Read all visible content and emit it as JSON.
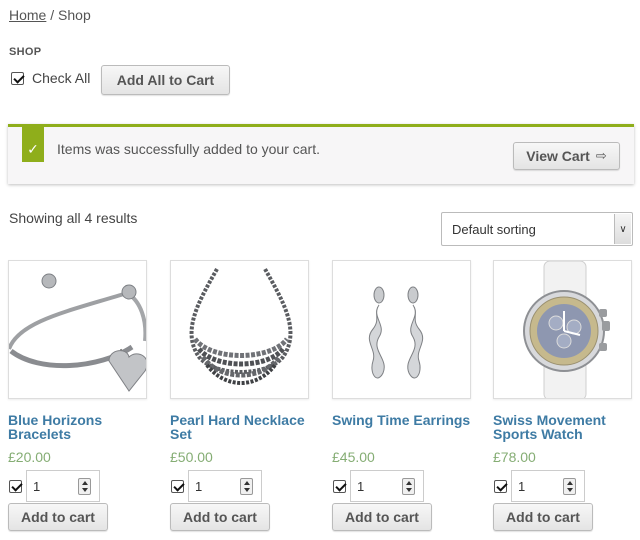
{
  "breadcrumb": {
    "home": "Home",
    "separator": " / ",
    "current": "Shop"
  },
  "section_label": "SHOP",
  "check_all": {
    "label": "Check All",
    "checked": true
  },
  "add_all_button": "Add All to Cart",
  "notice": {
    "icon": "check-icon",
    "message": "Items was successfully added to your cart.",
    "view_cart_label": "View Cart",
    "accent_color": "#8fae1b"
  },
  "result_count": "Showing all 4 results",
  "sorting": {
    "selected": "Default sorting"
  },
  "colors": {
    "product_name": "#3e7ba4",
    "price": "#85ad74"
  },
  "products": [
    {
      "name": "Blue Horizons Bracelets",
      "price": "£20.00",
      "qty": "1",
      "checked": true,
      "button": "Add to cart",
      "image": "bracelet-image"
    },
    {
      "name": "Pearl Hard Necklace Set",
      "price": "£50.00",
      "qty": "1",
      "checked": true,
      "button": "Add to cart",
      "image": "necklace-image"
    },
    {
      "name": "Swing Time Earrings",
      "price": "£45.00",
      "qty": "1",
      "checked": true,
      "button": "Add to cart",
      "image": "earrings-image"
    },
    {
      "name": "Swiss Movement Sports Watch",
      "price": "£78.00",
      "qty": "1",
      "checked": true,
      "button": "Add to cart",
      "image": "watch-image"
    }
  ]
}
